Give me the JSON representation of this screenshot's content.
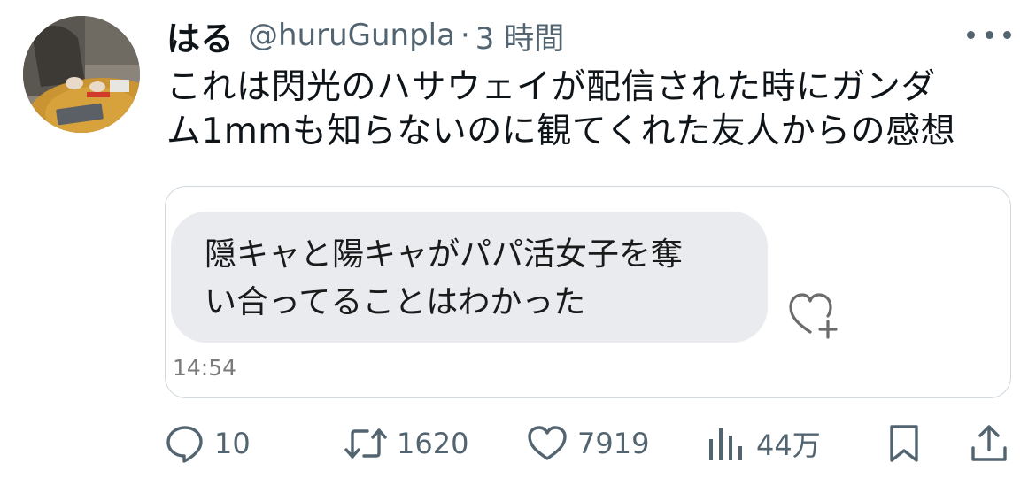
{
  "tweet": {
    "author": {
      "display_name": "はる",
      "handle": "@huruGunpla",
      "separator": "·",
      "time_ago": "3 時間"
    },
    "text_lines": [
      "これは閃光のハサウェイが配信された時にガンダ",
      "ム1mmも知らないのに観てくれた友人からの感想"
    ],
    "attached_image": {
      "message_lines": [
        "隠キャと陽キャがパパ活女子を奪",
        "い合ってることはわかった"
      ],
      "timestamp": "14:54"
    },
    "metrics": {
      "replies": "10",
      "retweets": "1620",
      "likes": "7919",
      "views": "44万"
    }
  },
  "colors": {
    "text": "#0f1419",
    "secondary": "#536471",
    "border": "#cfd9de",
    "bubble": "#e9ebee"
  }
}
